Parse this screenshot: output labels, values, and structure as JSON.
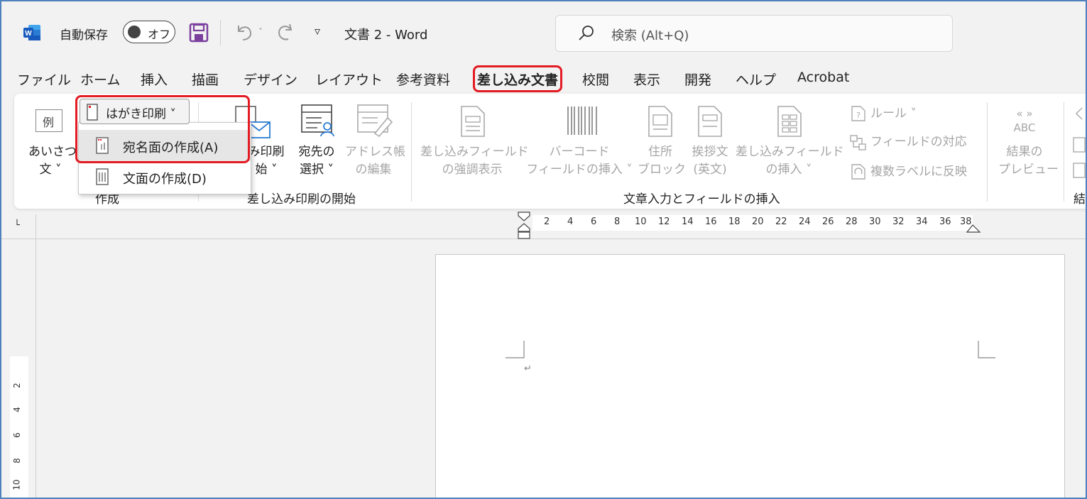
{
  "titlebar": {
    "app_icon": "word-icon",
    "autosave_label": "自動保存",
    "autosave_state": "オフ",
    "qat_more": "▿",
    "doc_title": "文書 2  -  Word",
    "search_placeholder": "検索 (Alt+Q)"
  },
  "tabs": [
    "ファイル",
    "ホーム",
    "挿入",
    "描画",
    "デザイン",
    "レイアウト",
    "参考資料",
    "差し込み文書",
    "校閲",
    "表示",
    "開発",
    "ヘルプ",
    "Acrobat"
  ],
  "active_tab": "差し込み文書",
  "ribbon": {
    "create_group": {
      "label": "作成",
      "greeting_icon_text": "例",
      "greeting_line1": "あいさつ",
      "greeting_line2": "文 ˅",
      "hagaki_button": "はがき印刷 ˅"
    },
    "start_group": {
      "label": "差し込み印刷の開始",
      "start_merge_line1": "み印刷",
      "start_merge_line2": "始 ˅",
      "select_recipients_line1": "宛先の",
      "select_recipients_line2": "選択 ˅",
      "edit_list_line1": "アドレス帳",
      "edit_list_line2": "の編集"
    },
    "fields_group": {
      "label": "文章入力とフィールドの挿入",
      "highlight_line1": "差し込みフィールド",
      "highlight_line2": "の強調表示",
      "barcode_line1": "バーコード",
      "barcode_line2": "フィールドの挿入 ˅",
      "address_line1": "住所",
      "address_line2": "ブロック",
      "greeting_en_line1": "挨拶文",
      "greeting_en_line2": "(英文)",
      "insert_field_line1": "差し込みフィールド",
      "insert_field_line2": "の挿入 ˅",
      "rules": "ルール ˅",
      "match_fields": "フィールドの対応",
      "update_labels": "複数ラベルに反映"
    },
    "preview_group": {
      "label_partial": "結",
      "icon_text1": "« »",
      "icon_text2": "ABC",
      "preview_line1": "結果の",
      "preview_line2": "プレビュー"
    }
  },
  "dropdown": {
    "items": [
      {
        "label": "宛名面の作成(A)",
        "icon": "address-side-icon"
      },
      {
        "label": "文面の作成(D)",
        "icon": "message-side-icon"
      }
    ]
  },
  "ruler": {
    "corner": "└",
    "h_numbers": [
      "2",
      "4",
      "6",
      "8",
      "10",
      "12",
      "14",
      "16",
      "18",
      "20",
      "22",
      "24",
      "26",
      "28",
      "30",
      "32",
      "34",
      "36",
      "38"
    ],
    "v_numbers": [
      "2",
      "4",
      "6",
      "8",
      "10"
    ]
  },
  "document": {
    "paragraph_mark": "↵"
  },
  "colors": {
    "highlight_red": "#e31b23",
    "word_blue": "#185abd",
    "save_purple": "#7b3f9e",
    "frame_blue": "#4f81bd"
  }
}
